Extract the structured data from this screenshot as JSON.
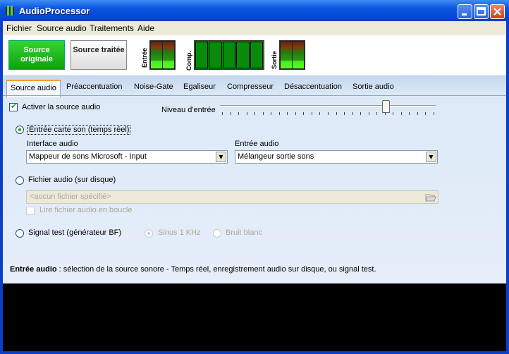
{
  "window": {
    "title": "AudioProcessor"
  },
  "menu": {
    "items": [
      "Fichier",
      "Source audio",
      "Traitements",
      "Aide"
    ]
  },
  "toolbar": {
    "source_original": "Source originale",
    "source_processed": "Source traitée",
    "label_input": "Entrée",
    "label_comp": "Comp.",
    "label_output": "Sortie"
  },
  "tabs": [
    "Source audio",
    "Préaccentuation",
    "Noise-Gate",
    "Egaliseur",
    "Compresseur",
    "Désaccentuation",
    "Sortie audio"
  ],
  "source": {
    "enable_label": "Activer la source audio",
    "enable_checked": true,
    "level_label": "Niveau d'entrée",
    "level_value": 0.78,
    "soundcard_label": "Entrée carte son (temps réel)",
    "interface_label": "Interface audio",
    "interface_value": "Mappeur de sons Microsoft - Input",
    "input_label": "Entrée audio",
    "input_value": "Mélangeur sortie sons",
    "file_label": "Fichier audio (sur disque)",
    "file_placeholder": "<aucun fichier spécifié>",
    "loop_label": "Lire fichier audio en boucle",
    "signal_label": "Signal test (générateur BF)",
    "sine_label": "Sinus 1 KHz",
    "noise_label": "Bruit blanc"
  },
  "help": {
    "title": "Entrée audio",
    "text": " : sélection de la source sonore - Temps réel, enregistrement audio sur disque, ou signal test."
  }
}
